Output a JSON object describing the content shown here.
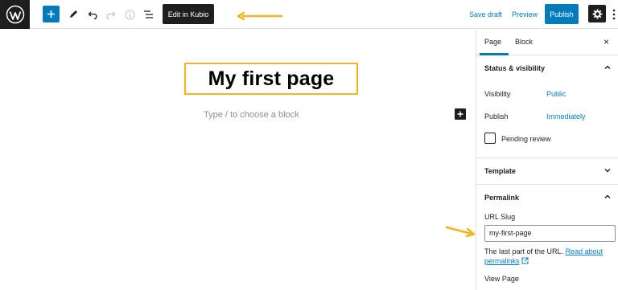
{
  "toolbar": {
    "edit_kubio_label": "Edit in Kubio",
    "save_draft_label": "Save draft",
    "preview_label": "Preview",
    "publish_label": "Publish"
  },
  "editor": {
    "title": "My first page",
    "block_placeholder": "Type / to choose a block"
  },
  "sidebar": {
    "tabs": [
      {
        "label": "Page"
      },
      {
        "label": "Block"
      }
    ],
    "close_symbol": "×",
    "status_visibility": {
      "heading": "Status & visibility",
      "visibility_label": "Visibility",
      "visibility_value": "Public",
      "publish_label": "Publish",
      "publish_value": "Immediately",
      "pending_review_label": "Pending review"
    },
    "template": {
      "heading": "Template"
    },
    "permalink": {
      "heading": "Permalink",
      "url_slug_label": "URL Slug",
      "url_slug_value": "my-first-page",
      "helper_text": "The last part of the URL.",
      "helper_link_1": "Read about",
      "helper_link_2": "permalinks",
      "view_page_label": "View Page"
    }
  },
  "colors": {
    "accent": "#007cba",
    "dark": "#1e1e1e",
    "highlight": "#f0b41f"
  },
  "icons": [
    "wordpress-logo-icon",
    "plus-icon",
    "pencil-icon",
    "undo-icon",
    "redo-icon",
    "info-icon",
    "list-view-icon",
    "gear-icon",
    "more-vertical-icon",
    "close-icon",
    "chevron-up-icon",
    "chevron-down-icon",
    "external-link-icon",
    "arrow-annotation-icon"
  ]
}
